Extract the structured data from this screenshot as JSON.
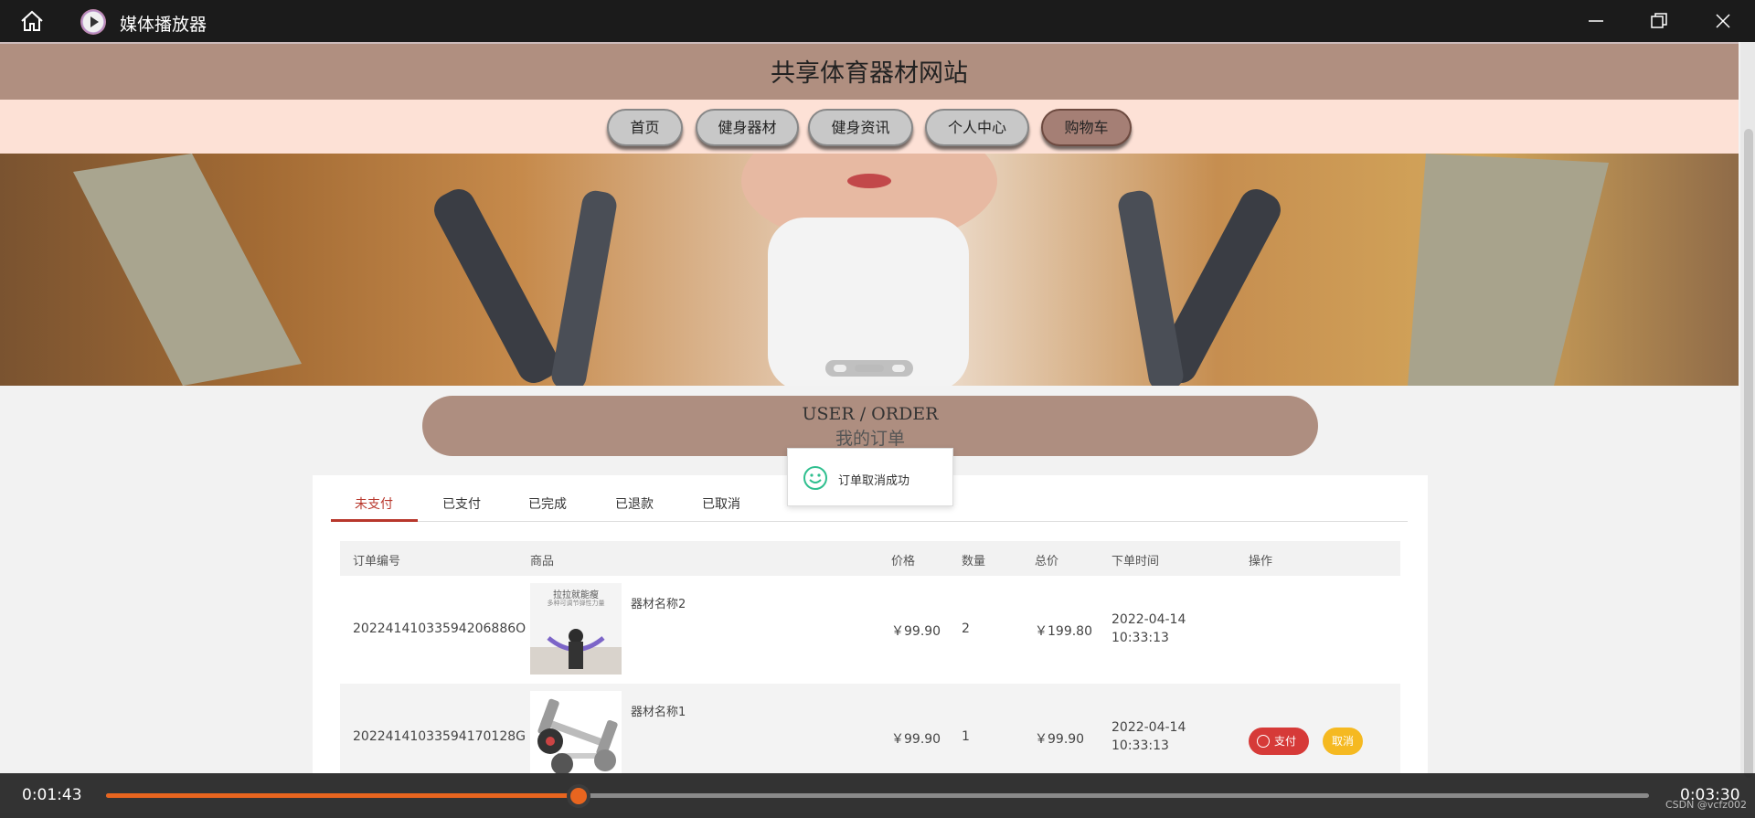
{
  "window": {
    "title": "媒体播放器"
  },
  "site": {
    "title": "共享体育器材网站",
    "nav": [
      {
        "label": "首页",
        "active": false
      },
      {
        "label": "健身器材",
        "active": false
      },
      {
        "label": "健身资讯",
        "active": false
      },
      {
        "label": "个人中心",
        "active": false
      },
      {
        "label": "购物车",
        "active": true
      }
    ]
  },
  "order_header": {
    "en": "USER / ORDER",
    "cn": "我的订单"
  },
  "tabs": [
    "未支付",
    "已支付",
    "已完成",
    "已退款",
    "已取消"
  ],
  "active_tab": "未支付",
  "table": {
    "headers": [
      "订单编号",
      "商品",
      "价格",
      "数量",
      "总价",
      "下单时间",
      "操作"
    ],
    "rows": [
      {
        "order_no": "20224141033594206886O",
        "product": "器材名称2",
        "price": "￥99.90",
        "qty": "2",
        "total": "￥199.80",
        "date": "2022-04-14",
        "time": "10:33:13",
        "thumb_text": "拉拉就能瘦",
        "thumb_sub": "多种可调节弹性力量",
        "actions": []
      },
      {
        "order_no": "20224141033594170128G",
        "product": "器材名称1",
        "price": "￥99.90",
        "qty": "1",
        "total": "￥99.90",
        "date": "2022-04-14",
        "time": "10:33:13",
        "actions": [
          "支付",
          "取消"
        ]
      }
    ]
  },
  "toast": {
    "message": "订单取消成功"
  },
  "player": {
    "current": "0:01:43",
    "total": "0:03:30",
    "progress": 0.3065
  },
  "watermark": "CSDN @vcfz002",
  "colors": {
    "header": "#b08f80",
    "nav_bg": "#fde1d6",
    "accent_red": "#b8372c",
    "pay": "#d63a38",
    "cancel": "#f5b921",
    "progress": "#e8651f"
  }
}
